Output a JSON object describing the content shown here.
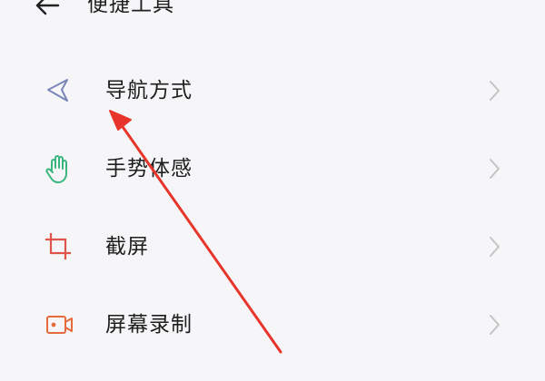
{
  "header": {
    "title": "便捷工具",
    "back_icon": "arrow-left-icon"
  },
  "menu": {
    "items": [
      {
        "label": "导航方式",
        "icon": "navigation-arrow-icon",
        "icon_color": "#7b86b8"
      },
      {
        "label": "手势体感",
        "icon": "hand-gesture-icon",
        "icon_color": "#3bb580"
      },
      {
        "label": "截屏",
        "icon": "crop-screenshot-icon",
        "icon_color": "#e0554b"
      },
      {
        "label": "屏幕录制",
        "icon": "screen-record-icon",
        "icon_color": "#e66a3c"
      }
    ],
    "chevron_icon": "chevron-right-icon",
    "chevron_color": "#c4c4c4"
  },
  "annotation": {
    "arrow_color": "#e8352b"
  }
}
